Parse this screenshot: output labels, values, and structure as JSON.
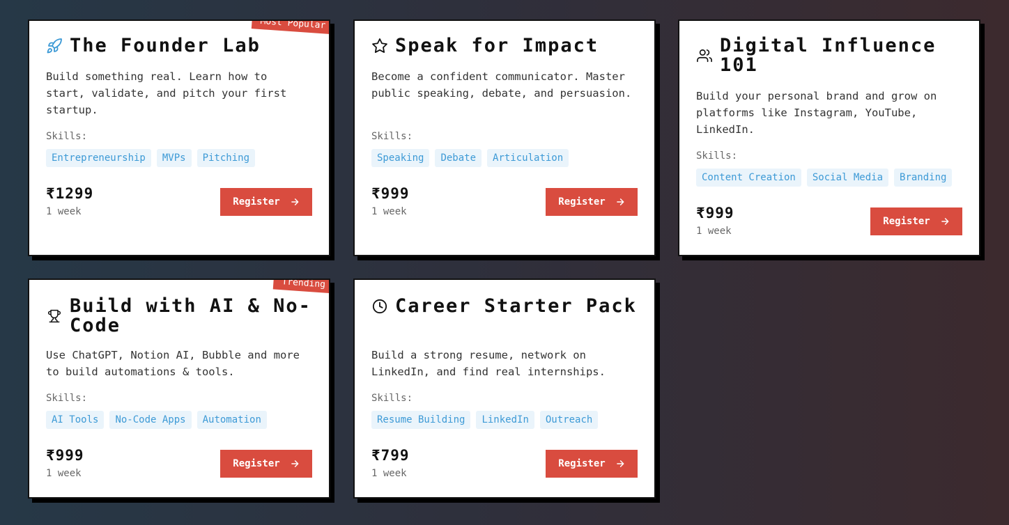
{
  "common": {
    "skills_label": "Skills:",
    "register_label": "Register"
  },
  "cards": [
    {
      "title": "The Founder Lab",
      "ribbon": "Most Popular",
      "icon": "rocket-icon",
      "description": "Build something real. Learn how to start, validate, and pitch your first startup.",
      "skills": [
        "Entrepreneurship",
        "MVPs",
        "Pitching"
      ],
      "price": "₹1299",
      "duration": "1 week"
    },
    {
      "title": "Speak for Impact",
      "icon": "star-icon",
      "description": "Become a confident communicator. Master public speaking, debate, and persuasion.",
      "skills": [
        "Speaking",
        "Debate",
        "Articulation"
      ],
      "price": "₹999",
      "duration": "1 week"
    },
    {
      "title": "Digital Influence 101",
      "icon": "users-icon",
      "description": "Build your personal brand and grow on platforms like Instagram, YouTube, LinkedIn.",
      "skills": [
        "Content Creation",
        "Social Media",
        "Branding"
      ],
      "price": "₹999",
      "duration": "1 week"
    },
    {
      "title": "Build with AI & No-Code",
      "ribbon": "Trending",
      "icon": "trophy-icon",
      "description": "Use ChatGPT, Notion AI, Bubble and more to build automations & tools.",
      "skills": [
        "AI Tools",
        "No-Code Apps",
        "Automation"
      ],
      "price": "₹999",
      "duration": "1 week"
    },
    {
      "title": "Career Starter Pack",
      "icon": "clock-icon",
      "description": "Build a strong resume, network on LinkedIn, and find real internships.",
      "skills": [
        "Resume Building",
        "LinkedIn",
        "Outreach"
      ],
      "price": "₹799",
      "duration": "1 week"
    }
  ],
  "colors": {
    "accent": "#d94c3f",
    "tag_bg": "#eaf4fb",
    "tag_text": "#3d9ad6",
    "rocket_icon": "#3d9ad6"
  }
}
